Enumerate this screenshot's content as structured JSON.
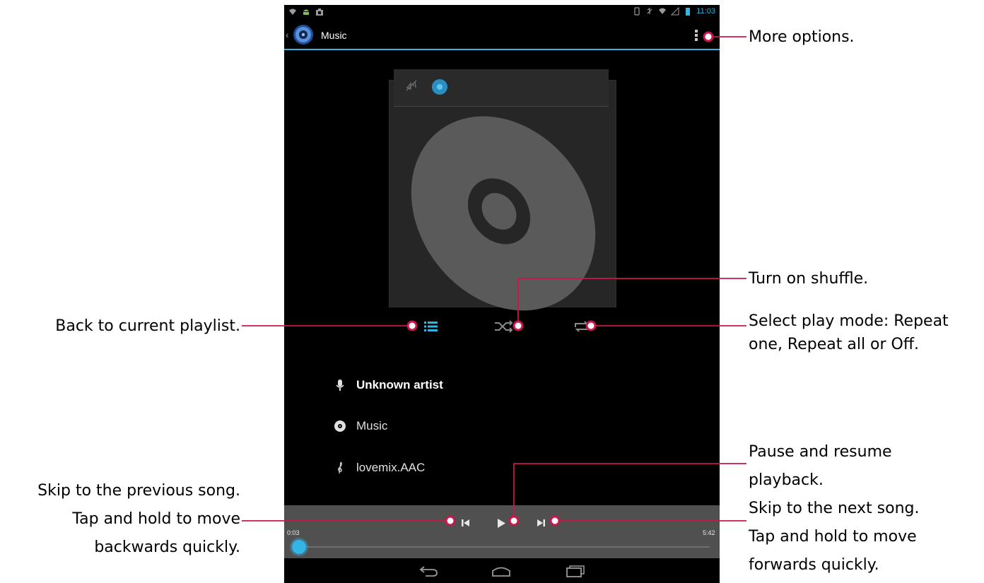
{
  "status_bar": {
    "time": "11:03"
  },
  "action_bar": {
    "title": "Music"
  },
  "track": {
    "artist": "Unknown artist",
    "album": "Music",
    "song": "lovemix.AAC"
  },
  "player": {
    "elapsed": "0:03",
    "duration": "5:42",
    "progress": 0.0088
  },
  "annotations": {
    "more_options": "More options.",
    "shuffle": "Turn on shuffle.",
    "play_mode_line1": "Select play mode: Repeat",
    "play_mode_line2": "one, Repeat all or Off.",
    "playlist": "Back to current playlist.",
    "pause_line1": "Pause and resume",
    "pause_line2": "playback.",
    "prev_line1": "Skip to the previous song.",
    "prev_line2": "Tap and hold to move",
    "prev_line3": "backwards quickly.",
    "next_line1": "Skip to the next song.",
    "next_line2": "Tap and hold to move",
    "next_line3": "forwards quickly."
  },
  "colors": {
    "accent": "#33b5e5",
    "callout_line": "#c8174a",
    "screen_bg": "#000000",
    "player_bg": "#505050"
  },
  "icons": [
    "wifi-icon",
    "android-icon",
    "notification-icon",
    "no-sim-icon",
    "mute-icon",
    "signal-icon",
    "battery-icon",
    "music-app-icon",
    "overflow-menu-icon",
    "mute-glyph-icon",
    "disc-icon",
    "playlist-icon",
    "shuffle-icon",
    "repeat-icon",
    "microphone-icon",
    "album-icon",
    "treble-clef-icon",
    "previous-icon",
    "play-icon",
    "next-icon",
    "back-icon",
    "home-icon",
    "recents-icon"
  ]
}
